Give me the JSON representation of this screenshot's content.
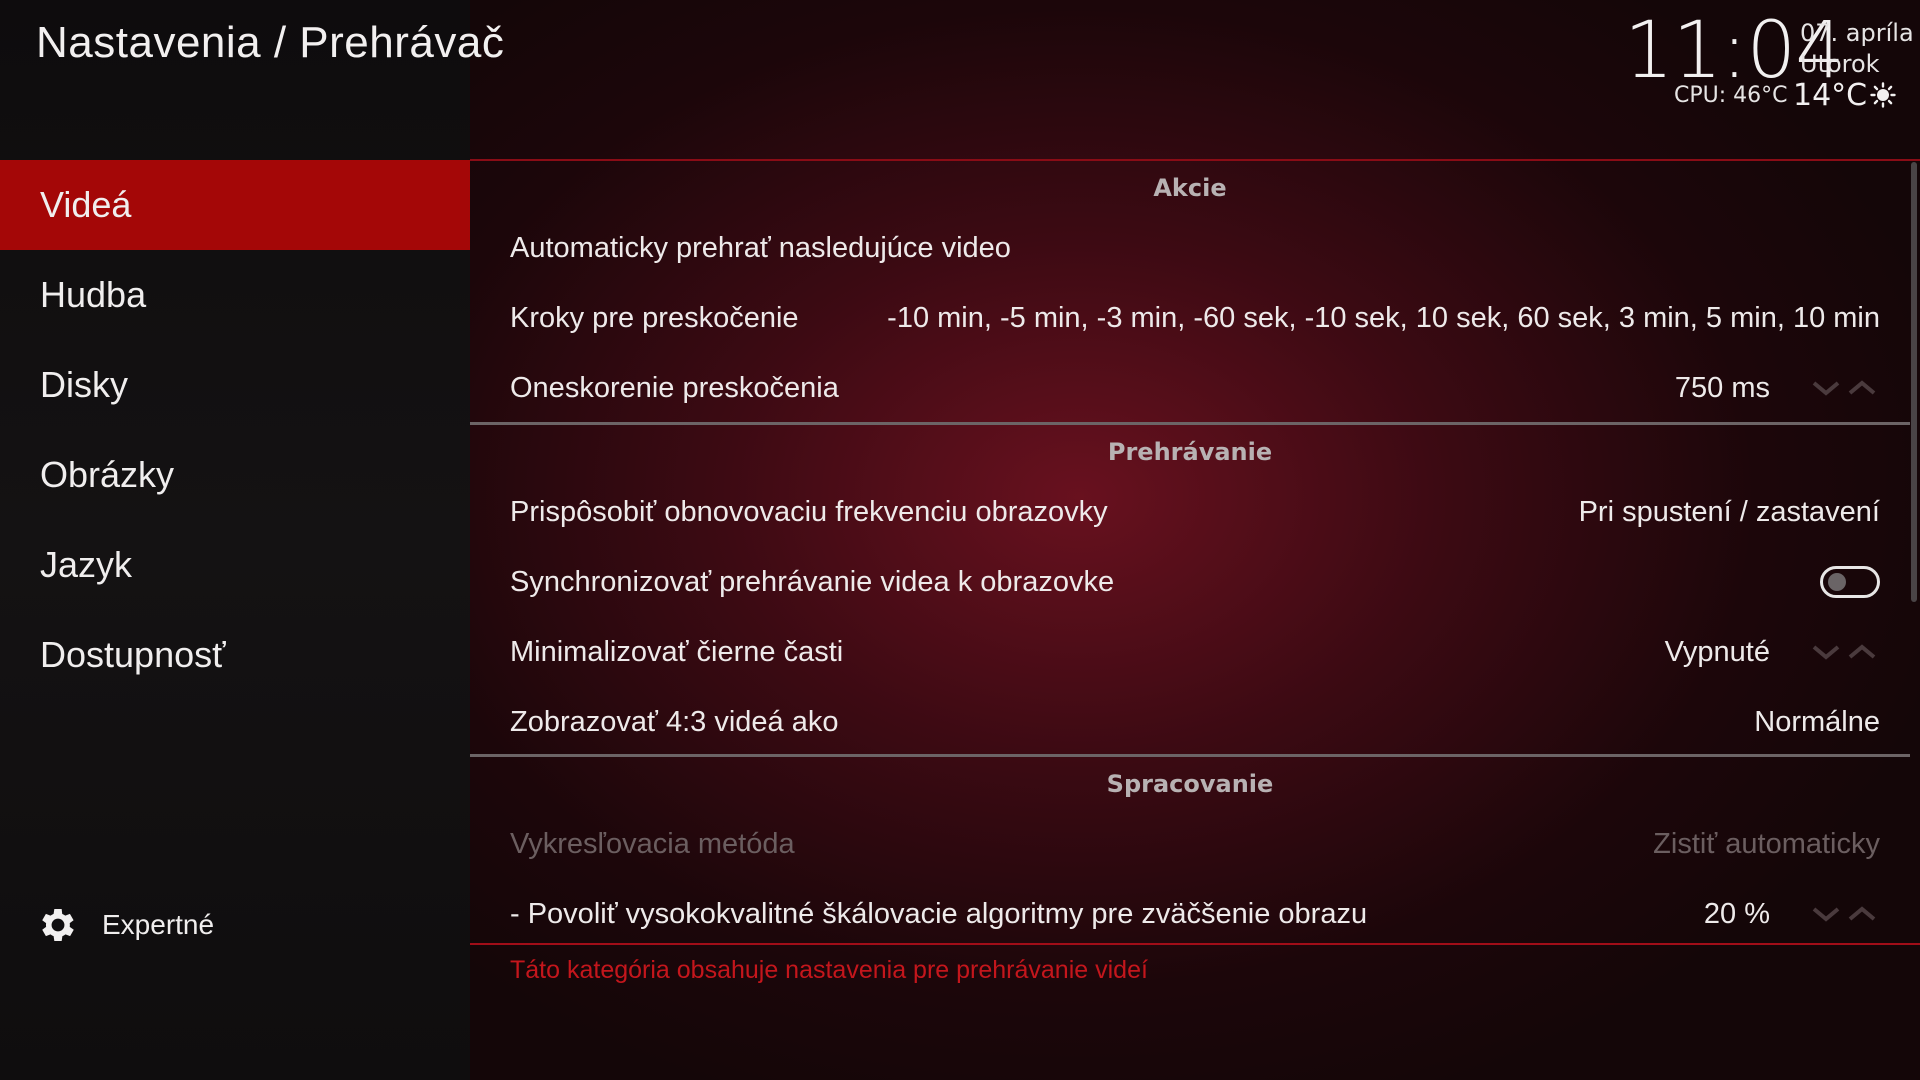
{
  "header": {
    "title": "Nastavenia / Prehrávač",
    "time": "11:04",
    "date": "07. apríla",
    "weekday": "Utorok",
    "cpu": "CPU: 46°C",
    "temperature": "14°C",
    "weather_icon": "sun-icon"
  },
  "sidebar": {
    "categories": [
      {
        "label": "Videá",
        "active": true
      },
      {
        "label": "Hudba",
        "active": false
      },
      {
        "label": "Disky",
        "active": false
      },
      {
        "label": "Obrázky",
        "active": false
      },
      {
        "label": "Jazyk",
        "active": false
      },
      {
        "label": "Dostupnosť",
        "active": false
      }
    ],
    "level_label": "Expertné",
    "level_icon": "gear-icon"
  },
  "sections": {
    "actions": {
      "header": "Akcie",
      "autoplay": {
        "label": "Automaticky prehrať nasledujúce video"
      },
      "skip_steps": {
        "label": "Kroky pre preskočenie",
        "value": "-10 min, -5 min, -3 min, -60 sek, -10 sek, 10 sek, 60 sek, 3 min, 5 min, 10 min"
      },
      "skip_delay": {
        "label": "Oneskorenie preskočenia",
        "value": "750 ms"
      }
    },
    "playback": {
      "header": "Prehrávanie",
      "refresh_rate": {
        "label": "Prispôsobiť obnovovaciu frekvenciu obrazovky",
        "value": "Pri spustení / zastavení"
      },
      "sync": {
        "label": "Synchronizovať prehrávanie videa k obrazovke",
        "enabled": false
      },
      "black_bars": {
        "label": "Minimalizovať čierne časti",
        "value": "Vypnuté"
      },
      "aspect_43": {
        "label": "Zobrazovať 4:3 videá ako",
        "value": "Normálne"
      }
    },
    "processing": {
      "header": "Spracovanie",
      "render_method": {
        "label": "Vykresľovacia metóda",
        "value": "Zistiť automaticky"
      },
      "upscaling": {
        "label": "- Povoliť vysokokvalitné škálovacie algoritmy pre zväčšenie obrazu",
        "value": "20 %"
      }
    }
  },
  "footer": {
    "description": "Táto kategória obsahuje nastavenia pre prehrávanie videí"
  },
  "colors": {
    "accent": "#a40707",
    "footer_text": "#c4161c",
    "disabled_text": "#6b5e60"
  }
}
